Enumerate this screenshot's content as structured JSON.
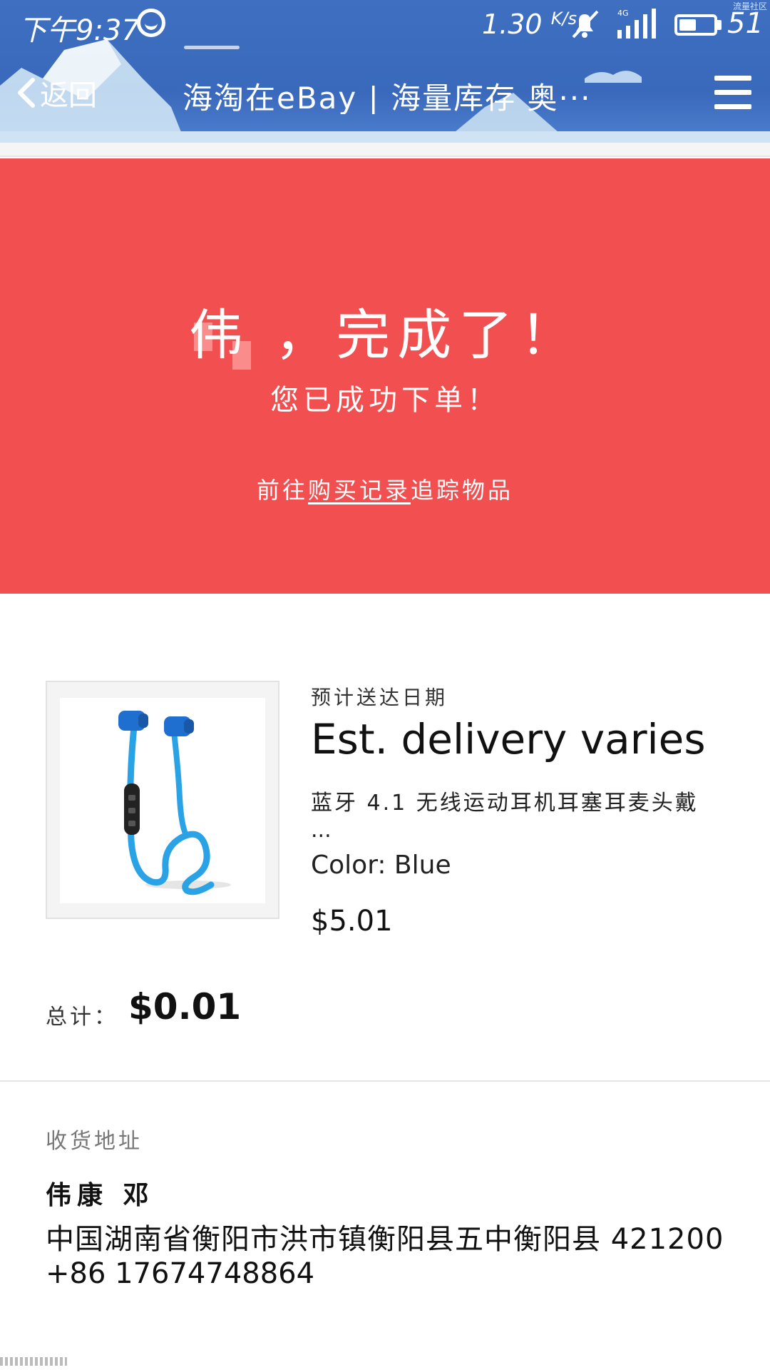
{
  "status_bar": {
    "time": "下午9:37",
    "speed": "1.30",
    "speed_unit": "K/s",
    "network": "4G",
    "battery": "51",
    "battery_level": 0.51
  },
  "corner_watermark": "流量社区",
  "nav": {
    "back_label": "返回",
    "title": "海淘在eBay | 海量库存 奥···"
  },
  "banner": {
    "title": "伟 ，完成了！",
    "subtitle": "您已成功下单！",
    "link_prefix": "前往",
    "link_text": "购买记录",
    "link_suffix": "追踪物品",
    "background_color": "#f25050"
  },
  "order": {
    "est_label": "预计送达日期",
    "est_value": "Est. delivery varies",
    "item_title": "蓝牙 4.1 无线运动耳机耳塞耳麦头戴",
    "item_ellipsis": "...",
    "item_color": "Color: Blue",
    "item_price": "$5.01",
    "image_icon": "bluetooth-earphones-icon",
    "total_label": "总计：",
    "total_value": "$0.01"
  },
  "shipping": {
    "label": "收货地址",
    "name": "伟康 邓",
    "address": "中国湖南省衡阳市洪市镇衡阳县五中衡阳县 421200",
    "phone": "+86 17674748864"
  }
}
